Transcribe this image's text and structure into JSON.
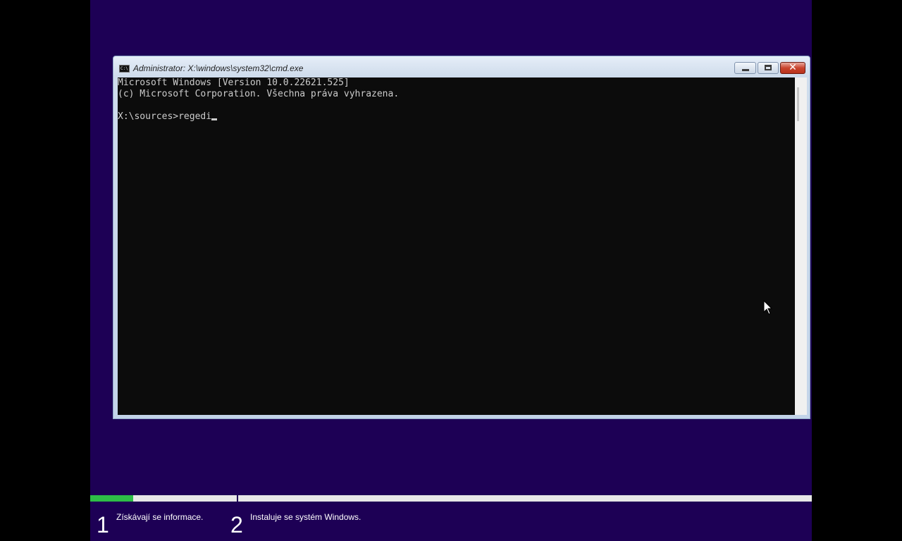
{
  "window": {
    "title": "Administrator: X:\\windows\\system32\\cmd.exe",
    "icon": "cmd-icon",
    "icon_text": "C:\\",
    "close_symbol": "✕",
    "titlebar_buttons": [
      "minimize-icon",
      "maximize-icon",
      "close-icon"
    ]
  },
  "console": {
    "line1": "Microsoft Windows [Version 10.0.22621.525]",
    "line2": "(c) Microsoft Corporation. Všechna práva vyhrazena.",
    "prompt": "X:\\sources>",
    "typed_input": "regedi"
  },
  "setup": {
    "progress_fraction": 0.06,
    "progress_color": "#2ebd47",
    "steps": [
      {
        "number": "1",
        "label": "Získávají se informace."
      },
      {
        "number": "2",
        "label": "Instaluje se systém Windows."
      }
    ]
  },
  "colors": {
    "setup_background": "#1d0055",
    "console_background": "#0c0c0c",
    "console_text": "#cccccc"
  }
}
